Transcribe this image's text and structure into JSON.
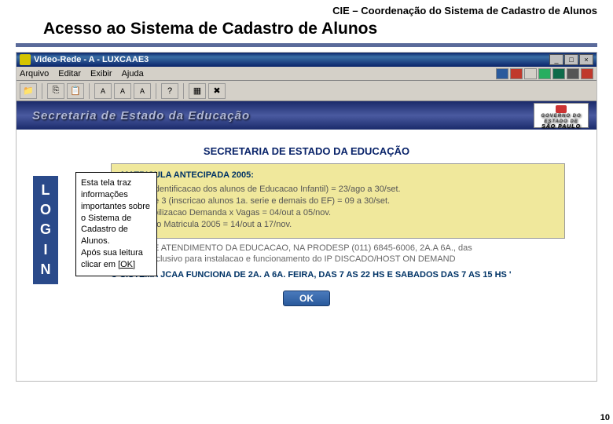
{
  "slide": {
    "header": "CIE – Coordenação do Sistema de Cadastro de Alunos",
    "title": "Acesso ao Sistema de Cadastro de Alunos",
    "page_num": "10"
  },
  "window": {
    "title": "Video-Rede - A - LUXCAAE3"
  },
  "menu": {
    "arquivo": "Arquivo",
    "editar": "Editar",
    "exibir": "Exibir",
    "ajuda": "Ajuda"
  },
  "banner": {
    "text": "Secretaria de Estado da Educação",
    "logo_state": "GOVERNO DO ESTADO DE",
    "logo_sp": "SÃO PAULO"
  },
  "page": {
    "title": "SECRETARIA DE ESTADO DA EDUCAÇÃO",
    "block_head": "MATRICULA ANTECIPADA 2005:",
    "line1": "Fase 1 (identificacao dos alunos de Educacao Infantil) = 23/ago a 30/set.",
    "line2": "Fases 2 e 3 (inscricao alunos 1a. serie e demais do EF) = 09 a 30/set.",
    "line3": "Compatibilizacao Demanda x Vagas = 04/out a 05/nov.",
    "line4": "Efetivacao Matricula 2005 = 14/out a 17/nov.",
    "below1": "ENTRAL DE ATENDIMENTO DA EDUCACAO, NA PRODESP  (011) 6845-6006, 2A.A 6A., das",
    "below2": "as 24hs. Exclusivo para instalacao e funcionamento do IP DISCADO/HOST ON DEMAND",
    "below_head": "O SISTEMA JCAA FUNCIONA DE 2A. A 6A. FEIRA, DAS 7 AS 22 HS E SABADOS DAS 7 AS 15 HS '",
    "ok": "OK"
  },
  "callout": {
    "text1": "Esta tela traz informações importantes sobre o Sistema de Cadastro de Alunos.",
    "text2": " Após sua leitura clicar em ",
    "ok": "[OK]"
  },
  "login": {
    "l": "L",
    "o": "O",
    "g": "G",
    "i": "I",
    "n": "N"
  }
}
